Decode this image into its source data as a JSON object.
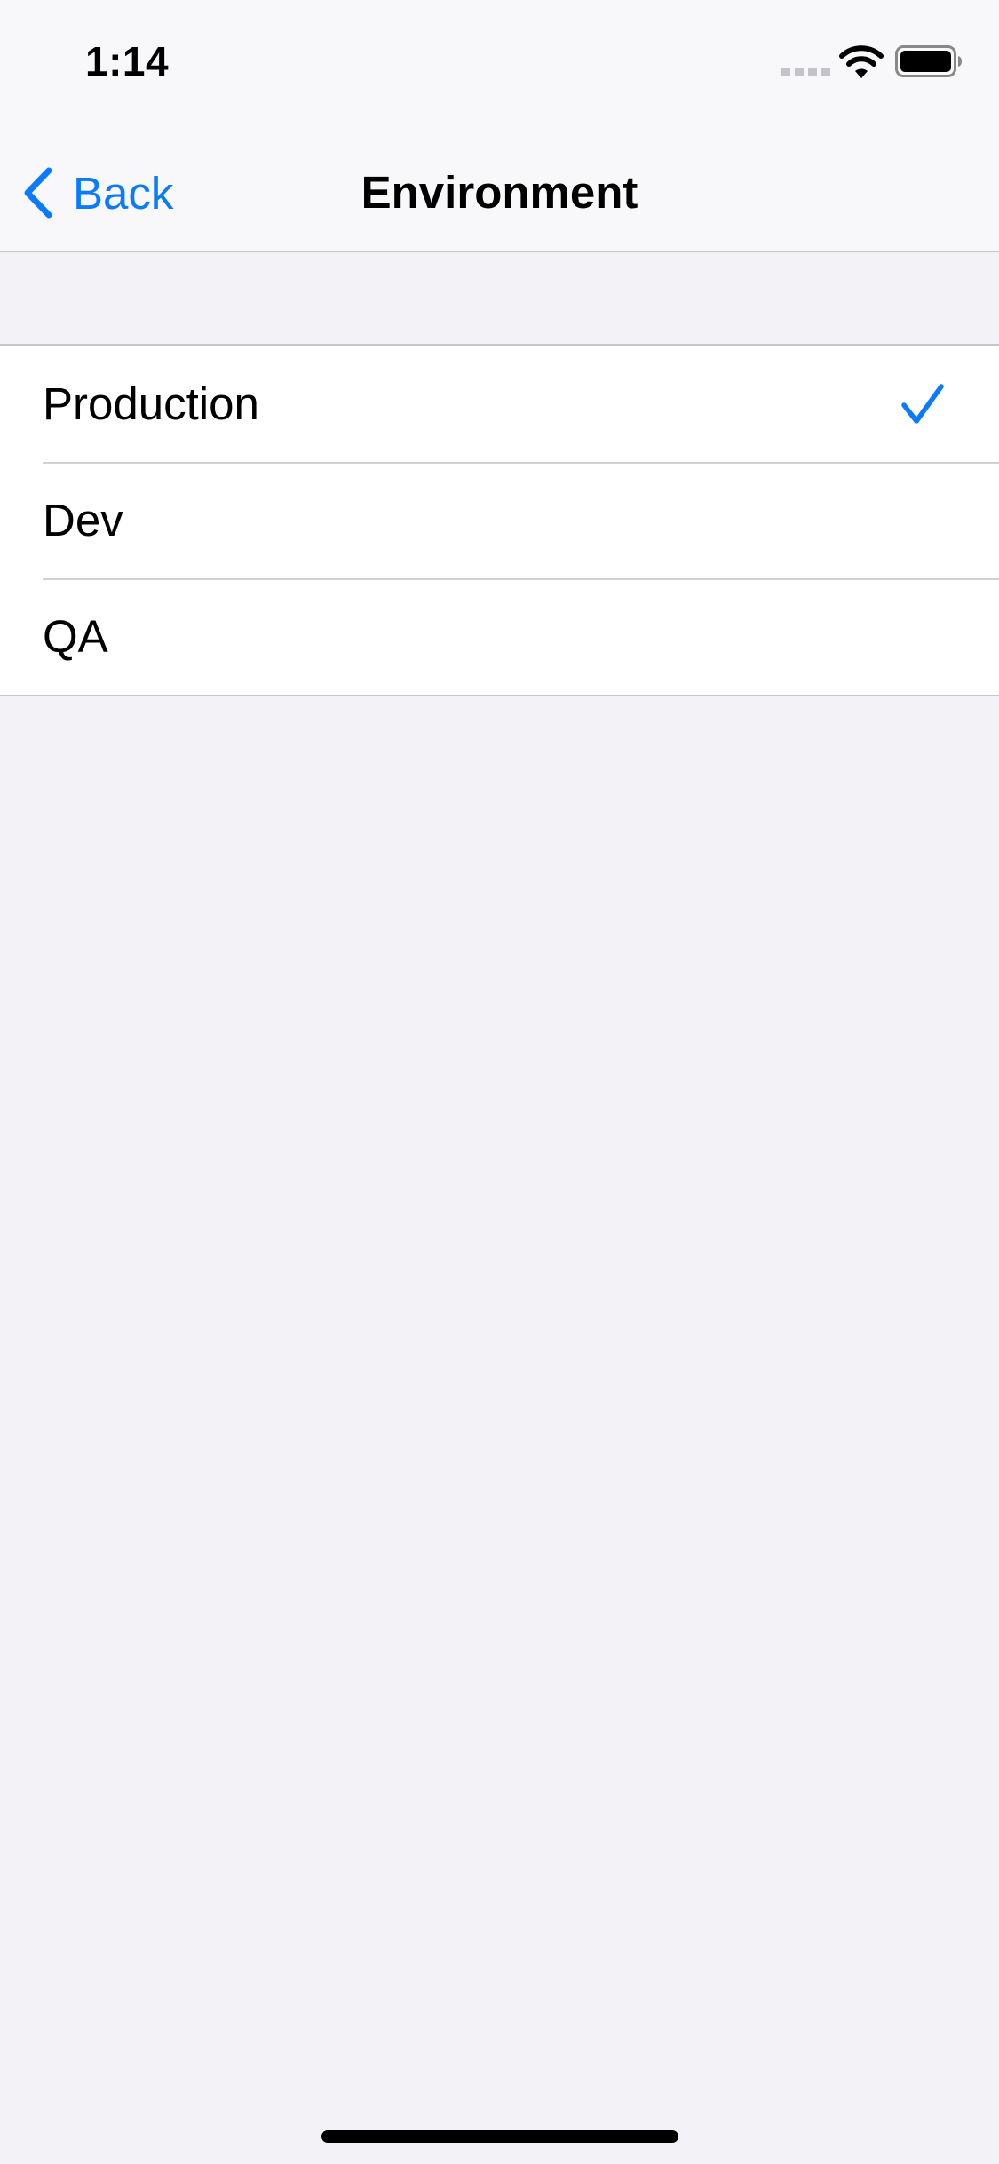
{
  "status_bar": {
    "time": "1:14",
    "icons": [
      "signal-icon",
      "wifi-icon",
      "battery-icon"
    ]
  },
  "nav": {
    "back_label": "Back",
    "title": "Environment"
  },
  "environments": [
    {
      "label": "Production",
      "selected": true
    },
    {
      "label": "Dev",
      "selected": false
    },
    {
      "label": "QA",
      "selected": false
    }
  ],
  "colors": {
    "accent": "#0a7aff",
    "background": "#f2f2f7",
    "separator": "#c6c6c8"
  }
}
